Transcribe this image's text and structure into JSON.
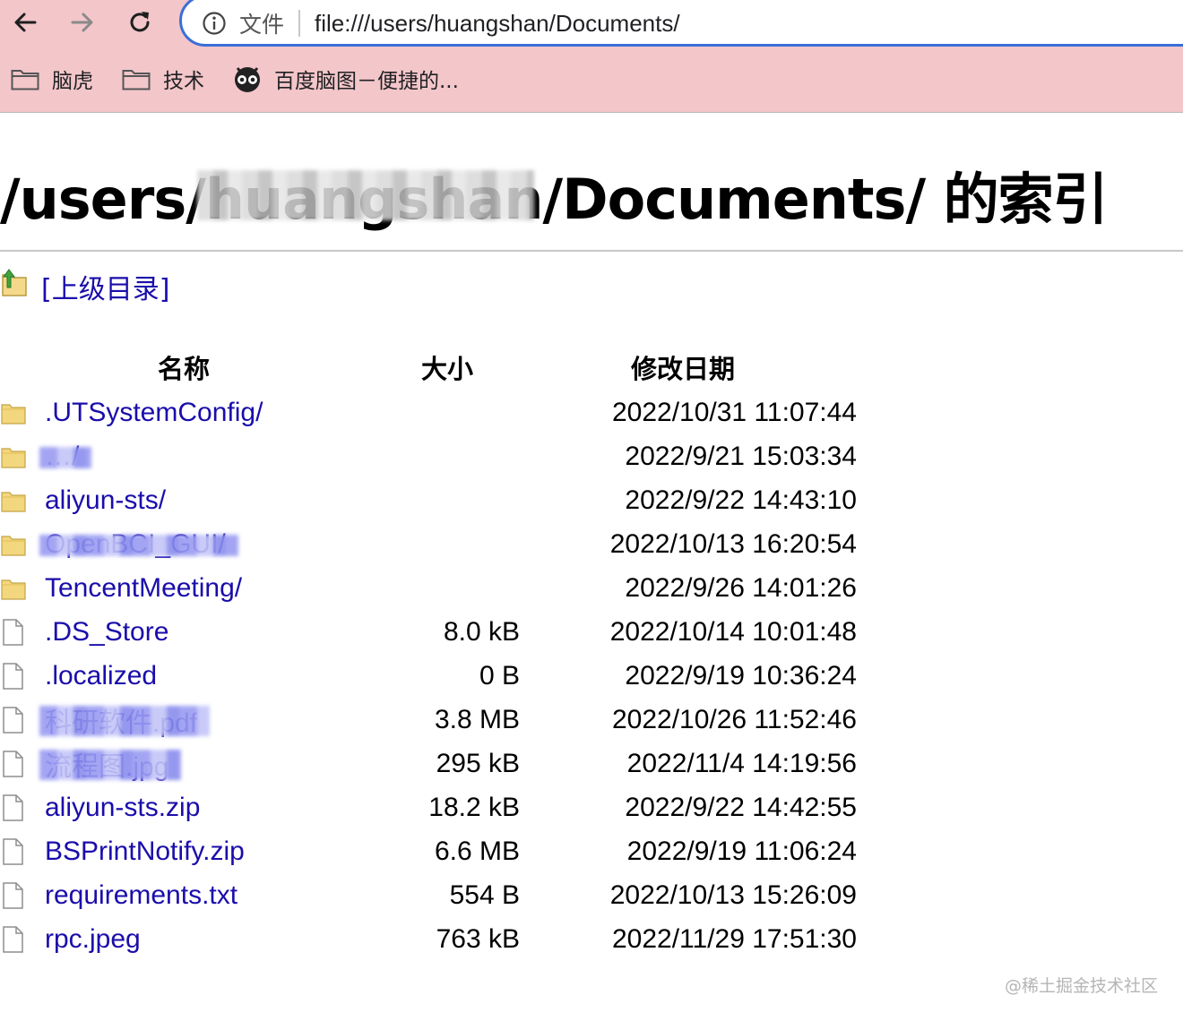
{
  "browser": {
    "chip_text": "文件",
    "url": "file:///users/huangshan/Documents/",
    "bookmarks": [
      {
        "label": "脑虎",
        "icon": "folder-icon"
      },
      {
        "label": "技术",
        "icon": "folder-icon"
      },
      {
        "label": "百度脑图－便捷的...",
        "icon": "owl-icon"
      }
    ]
  },
  "page": {
    "title": "/users/huangshan/Documents/ 的索引",
    "parent_link": "[上级目录]",
    "columns": {
      "name": "名称",
      "size": "大小",
      "date": "修改日期"
    },
    "entries": [
      {
        "name": ".UTSystemConfig/",
        "size": "",
        "date": "2022/10/31 11:07:44",
        "type": "folder",
        "redacted": false
      },
      {
        "name": "…/",
        "size": "",
        "date": "2022/9/21 15:03:34",
        "type": "folder",
        "redacted": true
      },
      {
        "name": "aliyun-sts/",
        "size": "",
        "date": "2022/9/22 14:43:10",
        "type": "folder",
        "redacted": false
      },
      {
        "name": "OpenBCI_GUI/",
        "size": "",
        "date": "2022/10/13 16:20:54",
        "type": "folder",
        "redacted": true
      },
      {
        "name": "TencentMeeting/",
        "size": "",
        "date": "2022/9/26 14:01:26",
        "type": "folder",
        "redacted": false
      },
      {
        "name": ".DS_Store",
        "size": "8.0 kB",
        "date": "2022/10/14 10:01:48",
        "type": "file",
        "redacted": false
      },
      {
        "name": ".localized",
        "size": "0 B",
        "date": "2022/9/19 10:36:24",
        "type": "file",
        "redacted": false
      },
      {
        "name": "科研软件.pdf",
        "size": "3.8 MB",
        "date": "2022/10/26 11:52:46",
        "type": "file",
        "redacted": true
      },
      {
        "name": "流程图.jpg",
        "size": "295 kB",
        "date": "2022/11/4 14:19:56",
        "type": "file",
        "redacted": true
      },
      {
        "name": "aliyun-sts.zip",
        "size": "18.2 kB",
        "date": "2022/9/22 14:42:55",
        "type": "file",
        "redacted": false
      },
      {
        "name": "BSPrintNotify.zip",
        "size": "6.6 MB",
        "date": "2022/9/19 11:06:24",
        "type": "file",
        "redacted": false
      },
      {
        "name": "requirements.txt",
        "size": "554 B",
        "date": "2022/10/13 15:26:09",
        "type": "file",
        "redacted": false
      },
      {
        "name": "rpc.jpeg",
        "size": "763 kB",
        "date": "2022/11/29 17:51:30",
        "type": "file",
        "redacted": false
      }
    ]
  },
  "watermark": "@稀土掘金技术社区",
  "colors": {
    "link": "#1a0dab",
    "chrome_bg": "#f3c6ca",
    "omnibox_border": "#3b6fd8"
  }
}
